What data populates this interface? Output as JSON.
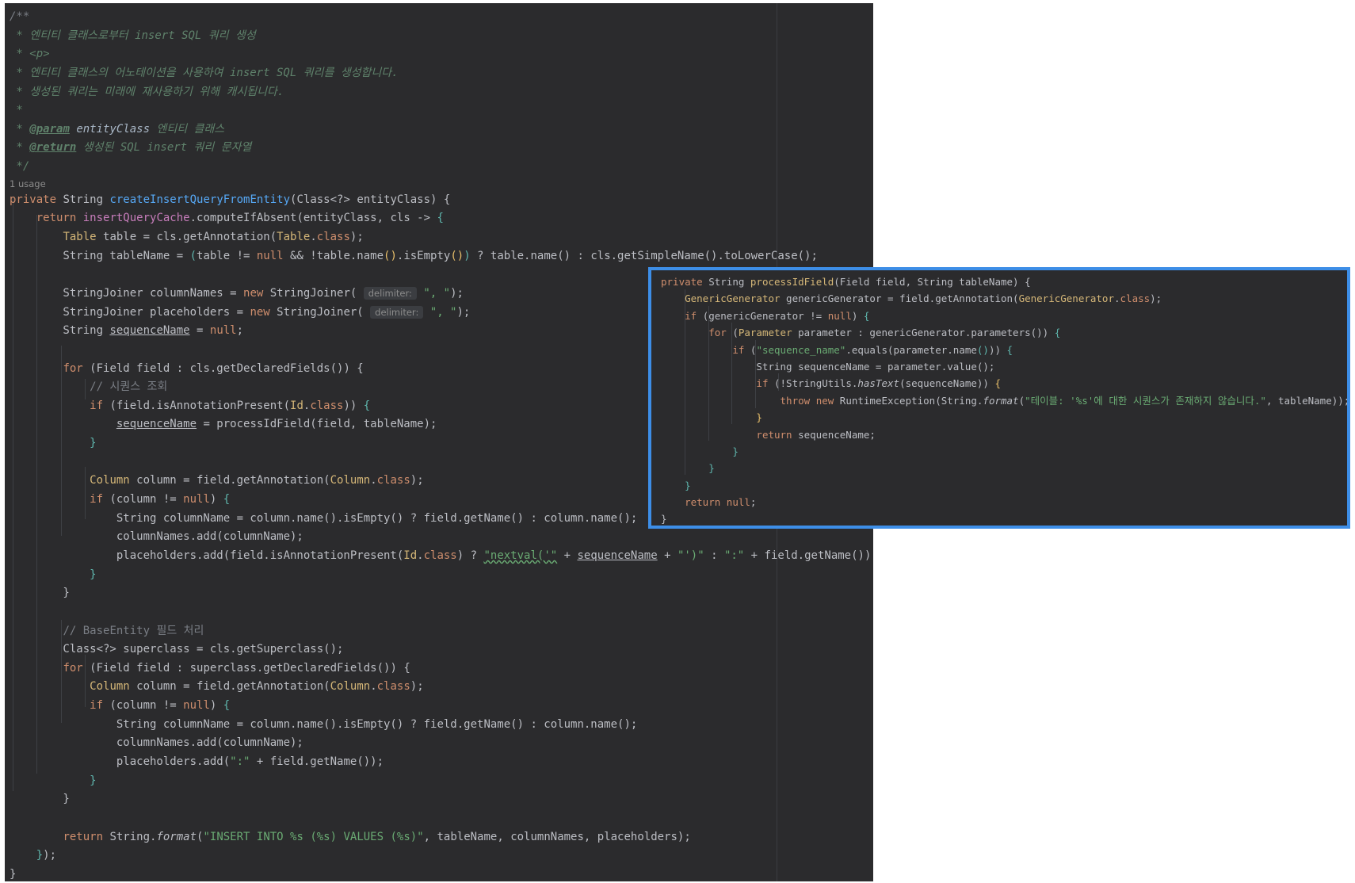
{
  "editor": {
    "usage_hint": "1 usage",
    "param_hint_label": "delimiter:",
    "doc_lines": [
      "/**",
      " * 엔티티 클래스로부터 ",
      "insert SQL",
      " 쿼리 생성",
      " * <p>",
      " * 엔티티 클래스의 어노테이션을 사용하여 ",
      "insert SQL",
      " 쿼리를 생성합니다.",
      " * 생성된 쿼리는 미래에 재사용하기 위해 캐시됩니다.",
      " *",
      "@param",
      "entityClass",
      " 엔티티 클래스",
      "@return",
      " 생성된 ",
      "SQL insert",
      " 쿼리 문자열",
      " */"
    ],
    "comments": {
      "sequence": "// 시퀀스 조회",
      "base_entity": "// BaseEntity 필드 처리"
    },
    "strings": {
      "comma": "\", \"",
      "nextval_open": "\"nextval('\"",
      "nextval_close": "\"')\"",
      "colon": "\":\"",
      "insert_format": "\"INSERT INTO %s (%s) VALUES (%s)\""
    }
  },
  "popup": {
    "strings": {
      "sequence_name": "\"sequence_name\"",
      "error_msg": "\"테이블: '%s'에 대한 시퀀스가 존재하지 않습니다.\""
    }
  }
}
